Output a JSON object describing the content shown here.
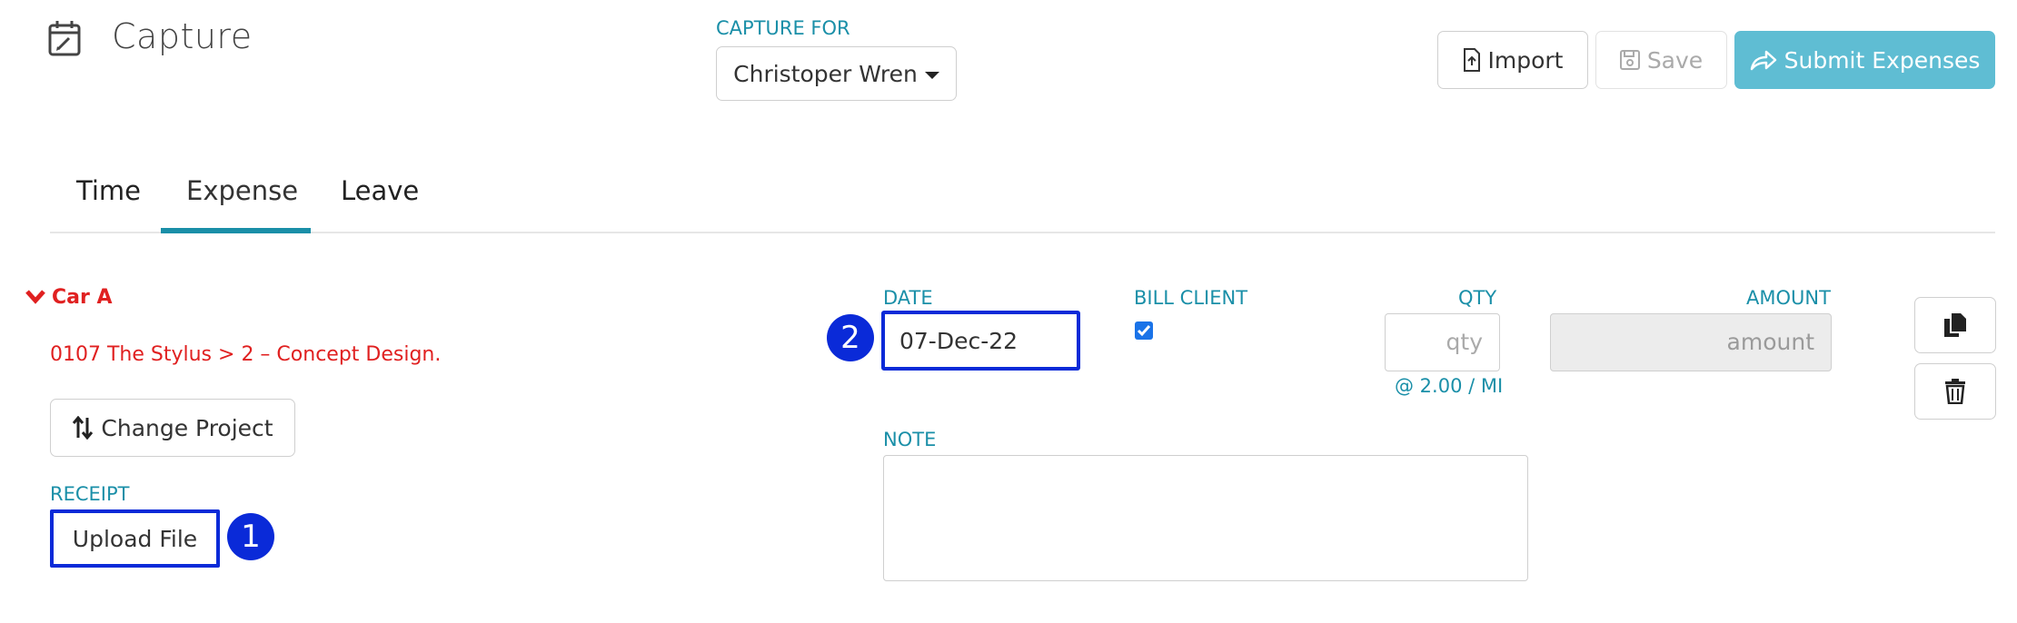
{
  "header": {
    "title": "Capture",
    "page_icon": "calendar-edit-icon",
    "capture_for_label": "CAPTURE FOR",
    "capture_for_value": "Christoper Wren",
    "buttons": {
      "import": "Import",
      "save": "Save",
      "submit": "Submit Expenses"
    }
  },
  "tabs": [
    {
      "label": "Time",
      "active": false
    },
    {
      "label": "Expense",
      "active": true
    },
    {
      "label": "Leave",
      "active": false
    }
  ],
  "item": {
    "title": "Car A",
    "project": "0107 The Stylus > 2 – Concept Design.",
    "change_project": "Change Project",
    "receipt_label": "RECEIPT",
    "upload": "Upload File",
    "date_label": "DATE",
    "date_value": "07-Dec-22",
    "bill_client_label": "BILL CLIENT",
    "bill_client_checked": true,
    "qty_label": "QTY",
    "qty_placeholder": "qty",
    "rate": "@ 2.00 / MI",
    "amount_label": "AMOUNT",
    "amount_placeholder": "amount",
    "note_label": "NOTE",
    "note_value": ""
  },
  "markers": [
    "1",
    "2"
  ],
  "colors": {
    "accent": "#1a8fa8",
    "submit": "#5fbdd3",
    "error": "#e02020",
    "highlight": "#0a2ad8"
  }
}
